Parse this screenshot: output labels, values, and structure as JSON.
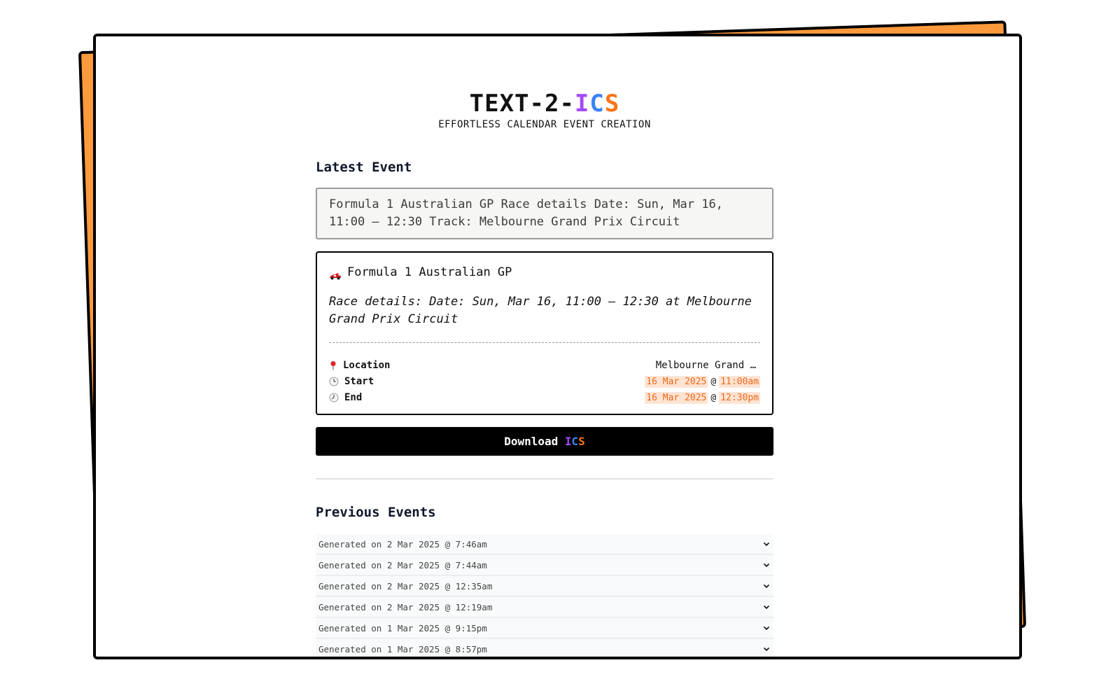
{
  "brand": {
    "prefix": "TEXT-2-",
    "letters": [
      "I",
      "C",
      "S"
    ],
    "tagline": "EFFORTLESS CALENDAR EVENT CREATION"
  },
  "latest": {
    "heading": "Latest Event",
    "input_value": "Formula 1 Australian GP Race details Date: Sun, Mar 16, 11:00 – 12:30 Track: Melbourne Grand Prix Circuit",
    "event": {
      "title": "Formula 1 Australian GP",
      "description": "Race details: Date: Sun, Mar 16, 11:00 – 12:30 at Melbourne Grand Prix Circuit",
      "location_label": "Location",
      "location_value": "Melbourne Grand …",
      "start_label": "Start",
      "start_date": "16 Mar 2025",
      "start_time": "11:00am",
      "end_label": "End",
      "end_date": "16 Mar 2025",
      "end_time": "12:30pm",
      "at": "@"
    },
    "download_label": "Download",
    "download_letters": [
      "I",
      "C",
      "S"
    ]
  },
  "previous": {
    "heading": "Previous Events",
    "items": [
      "Generated on 2 Mar 2025 @ 7:46am",
      "Generated on 2 Mar 2025 @ 7:44am",
      "Generated on 2 Mar 2025 @ 12:35am",
      "Generated on 2 Mar 2025 @ 12:19am",
      "Generated on 1 Mar 2025 @ 9:15pm",
      "Generated on 1 Mar 2025 @ 8:57pm"
    ]
  },
  "colors": {
    "accent_orange": "#FF9A3C",
    "letter_i": "#A34BFF",
    "letter_c": "#3B82F6",
    "letter_s": "#F97316",
    "highlight_bg": "#FFE4D3",
    "highlight_text": "#EA6A1D"
  },
  "icons": {
    "event": "race-car-icon",
    "location": "map-pin-icon",
    "start": "clock-icon",
    "end": "clock-icon",
    "expand": "chevron-down-icon"
  }
}
